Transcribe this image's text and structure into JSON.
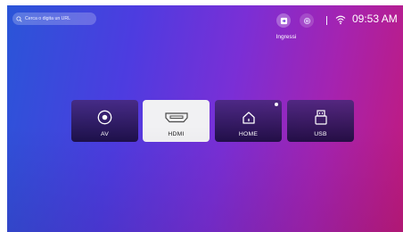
{
  "search": {
    "placeholder": "Cerca o digita un URL"
  },
  "status": {
    "inputs_label": "Ingressi",
    "time": "09:53 AM"
  },
  "sources": [
    {
      "label": "AV",
      "icon": "av-icon",
      "selected": false
    },
    {
      "label": "HDMI",
      "icon": "hdmi-icon",
      "selected": true
    },
    {
      "label": "HOME",
      "icon": "home-icon",
      "selected": false,
      "has_dot": true
    },
    {
      "label": "USB",
      "icon": "usb-icon",
      "selected": false
    }
  ],
  "colors": {
    "gradient_start": "#2a55d8",
    "gradient_mid": "#7a2fd6",
    "gradient_end": "#c21a7c",
    "tile_selected": "#f1f1f3"
  }
}
